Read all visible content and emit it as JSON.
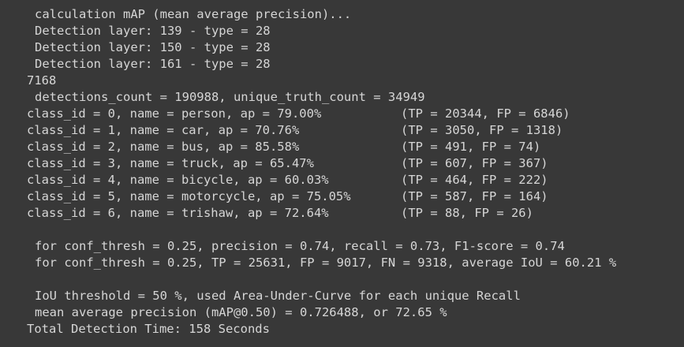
{
  "terminal": {
    "background": "#383838",
    "text_color": "#d6d6d6",
    "lines_top": [
      "calculation mAP (mean average precision)...",
      "Detection layer: 139 - type = 28",
      "Detection layer: 150 - type = 28",
      "Detection layer: 161 - type = 28"
    ],
    "count_line": "7168",
    "detections_line": "detections_count = 190988, unique_truth_count = 34949",
    "classes": [
      {
        "left": "class_id = 0, name = person, ap = 79.00%",
        "right": "(TP = 20344, FP = 6846)"
      },
      {
        "left": "class_id = 1, name = car, ap = 70.76%",
        "right": "(TP = 3050, FP = 1318)"
      },
      {
        "left": "class_id = 2, name = bus, ap = 85.58%",
        "right": "(TP = 491, FP = 74)"
      },
      {
        "left": "class_id = 3, name = truck, ap = 65.47%",
        "right": "(TP = 607, FP = 367)"
      },
      {
        "left": "class_id = 4, name = bicycle, ap = 60.03%",
        "right": "(TP = 464, FP = 222)"
      },
      {
        "left": "class_id = 5, name = motorcycle, ap = 75.05%",
        "right": "(TP = 587, FP = 164)"
      },
      {
        "left": "class_id = 6, name = trishaw, ap = 72.64%",
        "right": "(TP = 88, FP = 26)"
      }
    ],
    "thresh_lines": [
      "for conf_thresh = 0.25, precision = 0.74, recall = 0.73, F1-score = 0.74",
      "for conf_thresh = 0.25, TP = 25631, FP = 9017, FN = 9318, average IoU = 60.21 %"
    ],
    "summary_lines": [
      "IoU threshold = 50 %, used Area-Under-Curve for each unique Recall",
      "mean average precision (mAP@0.50) = 0.726488, or 72.65 %"
    ],
    "total_time_line": "Total Detection Time: 158 Seconds"
  }
}
